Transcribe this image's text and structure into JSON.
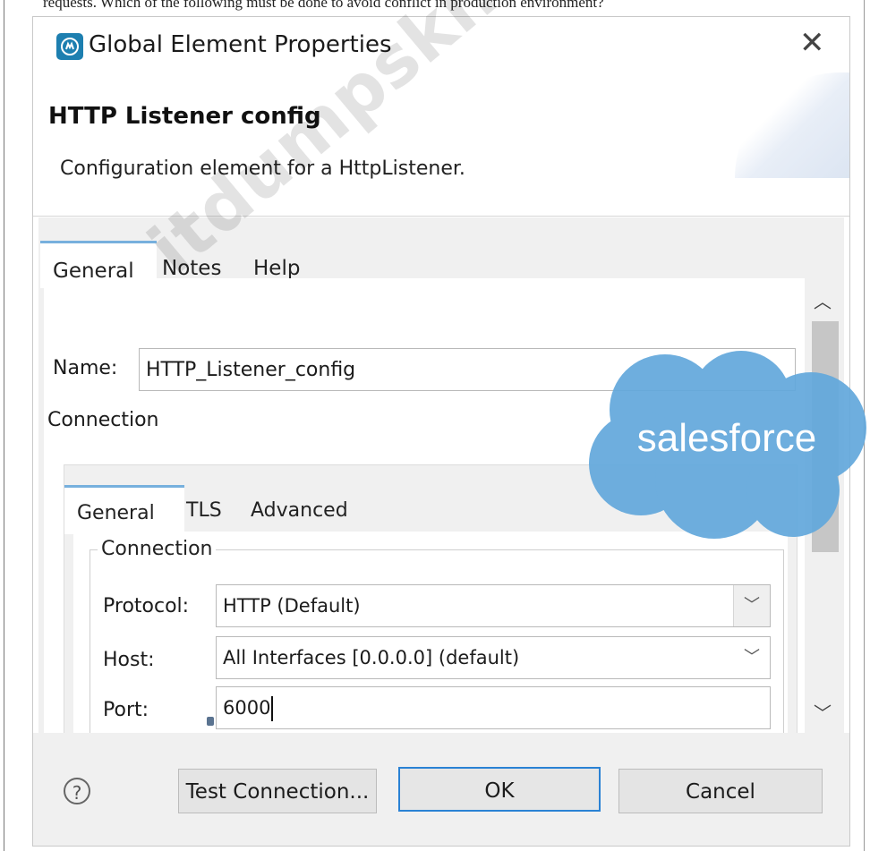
{
  "top_cut_text": "requests. Which of the following must be done to avoid conflict in production environment?",
  "dialog": {
    "title": "Global Element Properties",
    "heading": "HTTP Listener config",
    "description": "Configuration element for a HttpListener."
  },
  "outer_tabs": [
    "General",
    "Notes",
    "Help"
  ],
  "form": {
    "name_label": "Name:",
    "name_value": "HTTP_Listener_config",
    "section_label": "Connection"
  },
  "inner_tabs": [
    "General",
    "TLS",
    "Advanced"
  ],
  "connection": {
    "group_title": "Connection",
    "protocol_label": "Protocol:",
    "protocol_value": "HTTP (Default)",
    "host_label": "Host:",
    "host_value": "All Interfaces [0.0.0.0] (default)",
    "port_label": "Port:",
    "port_value": "6000"
  },
  "buttons": {
    "help": "?",
    "test_connection": "Test Connection...",
    "ok": "OK",
    "cancel": "Cancel"
  },
  "overlay": {
    "watermark": "itdumpskr.com",
    "logo_text": "salesforce",
    "logo_color": "#62a8dc"
  },
  "icons": {
    "close": "close-icon",
    "help": "help-icon",
    "scroll_up": "chevron-up-icon",
    "scroll_down": "chevron-down-icon",
    "dropdown": "chevron-down-icon"
  }
}
